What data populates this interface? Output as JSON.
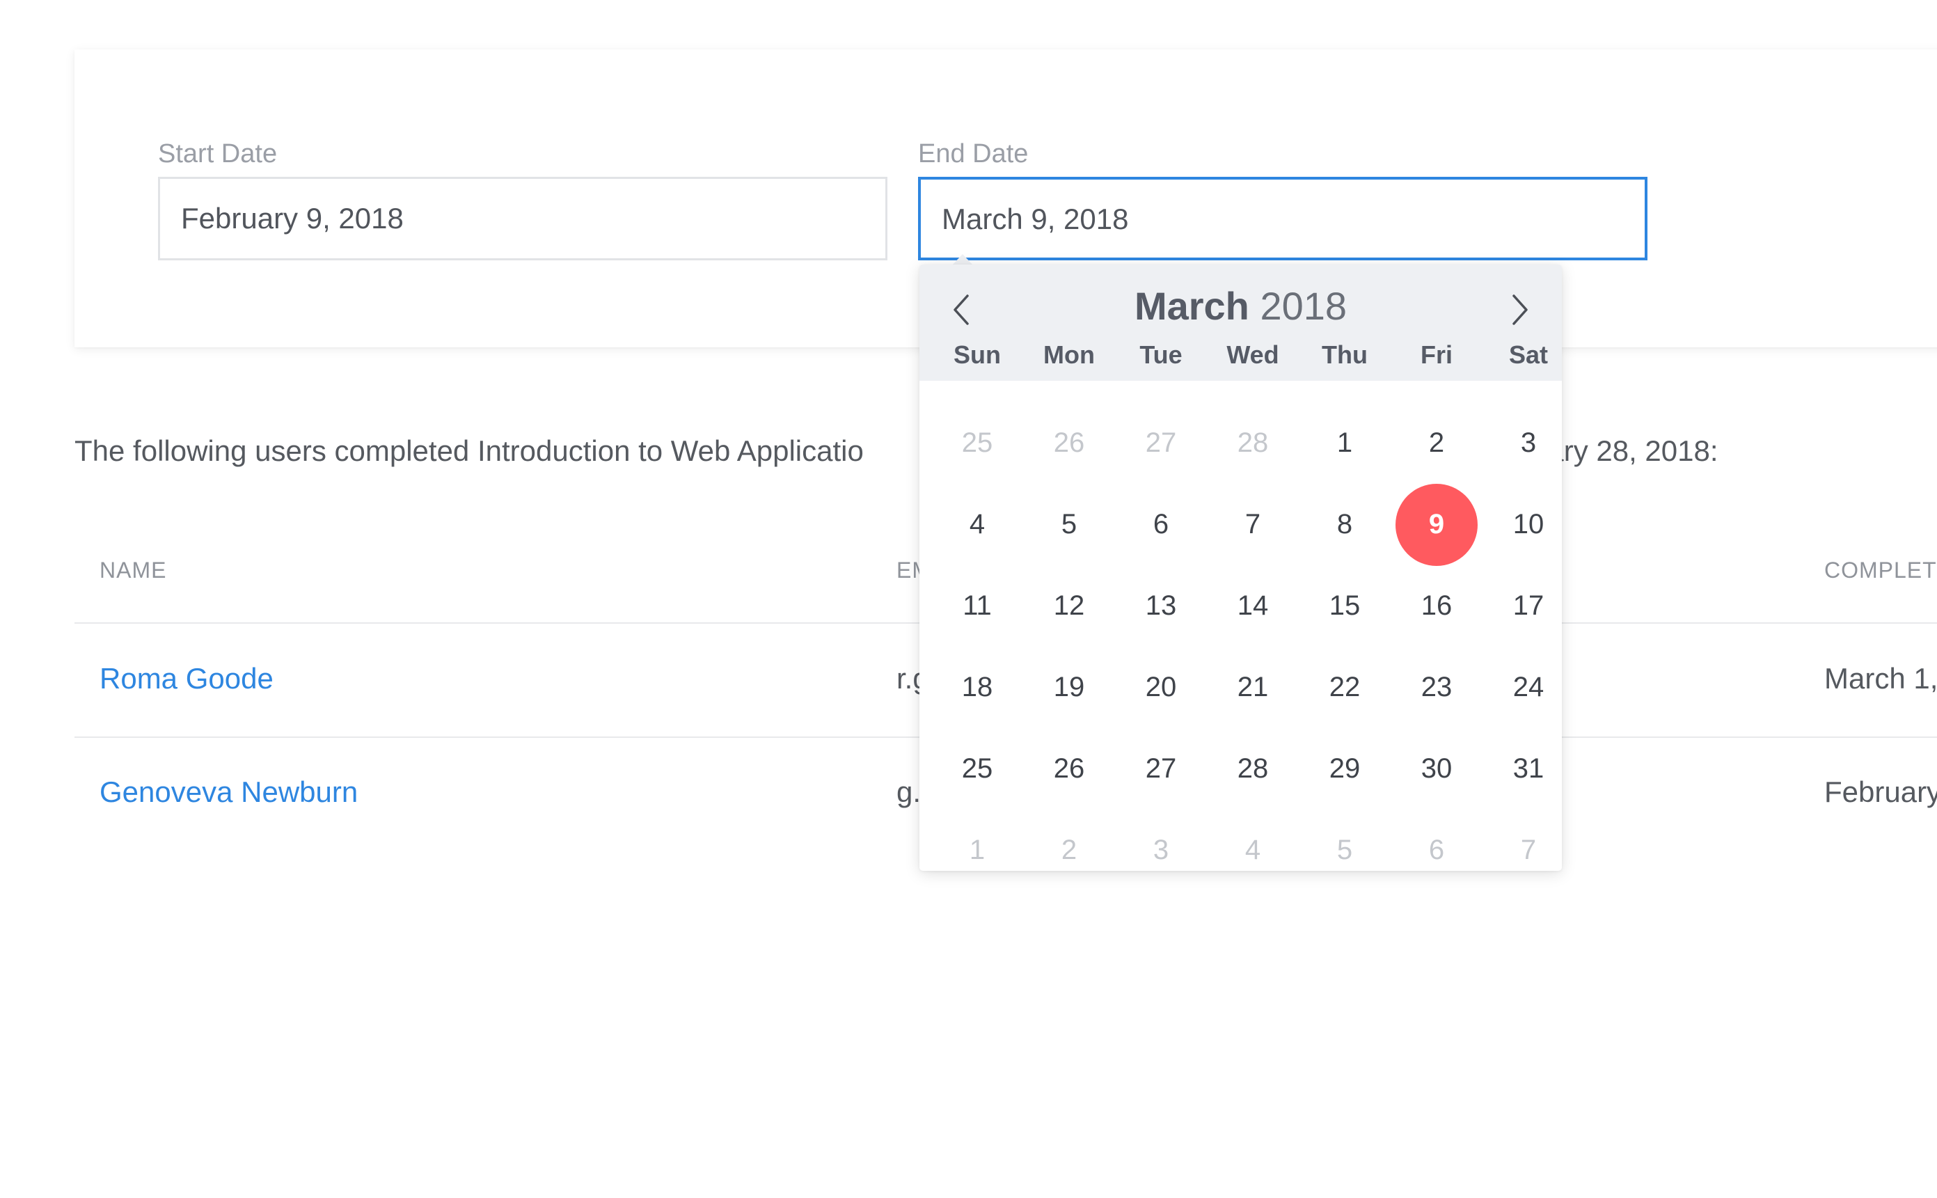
{
  "filters": {
    "start_label": "Start Date",
    "start_value": "February 9, 2018",
    "end_label": "End Date",
    "end_value": "March 9, 2018"
  },
  "summary_text": "The following users completed Introduction to Web Applicatio",
  "summary_tail": "uary 28, 2018:",
  "table": {
    "headers": {
      "name": "NAME",
      "email": "EM",
      "completed": "COMPLET"
    },
    "rows": [
      {
        "name": "Roma Goode",
        "email": "r.g",
        "completed": "March 1,"
      },
      {
        "name": "Genoveva Newburn",
        "email": "g.",
        "completed": "February"
      }
    ]
  },
  "datepicker": {
    "month": "March",
    "year": "2018",
    "prev_icon": "chevron-left-icon",
    "next_icon": "chevron-right-icon",
    "weekdays": [
      "Sun",
      "Mon",
      "Tue",
      "Wed",
      "Thu",
      "Fri",
      "Sat"
    ],
    "days": [
      {
        "d": "25",
        "muted": true
      },
      {
        "d": "26",
        "muted": true
      },
      {
        "d": "27",
        "muted": true
      },
      {
        "d": "28",
        "muted": true
      },
      {
        "d": "1"
      },
      {
        "d": "2"
      },
      {
        "d": "3"
      },
      {
        "d": "4"
      },
      {
        "d": "5"
      },
      {
        "d": "6"
      },
      {
        "d": "7"
      },
      {
        "d": "8"
      },
      {
        "d": "9",
        "selected": true
      },
      {
        "d": "10"
      },
      {
        "d": "11"
      },
      {
        "d": "12"
      },
      {
        "d": "13"
      },
      {
        "d": "14"
      },
      {
        "d": "15"
      },
      {
        "d": "16"
      },
      {
        "d": "17"
      },
      {
        "d": "18"
      },
      {
        "d": "19"
      },
      {
        "d": "20"
      },
      {
        "d": "21"
      },
      {
        "d": "22"
      },
      {
        "d": "23"
      },
      {
        "d": "24"
      },
      {
        "d": "25"
      },
      {
        "d": "26"
      },
      {
        "d": "27"
      },
      {
        "d": "28"
      },
      {
        "d": "29"
      },
      {
        "d": "30"
      },
      {
        "d": "31"
      },
      {
        "d": "1",
        "muted": true
      },
      {
        "d": "2",
        "muted": true
      },
      {
        "d": "3",
        "muted": true
      },
      {
        "d": "4",
        "muted": true
      },
      {
        "d": "5",
        "muted": true
      },
      {
        "d": "6",
        "muted": true
      },
      {
        "d": "7",
        "muted": true
      }
    ]
  },
  "colors": {
    "accent": "#2e86e0",
    "selected_day": "#ff5a5f",
    "header_bg": "#eef0f3"
  }
}
